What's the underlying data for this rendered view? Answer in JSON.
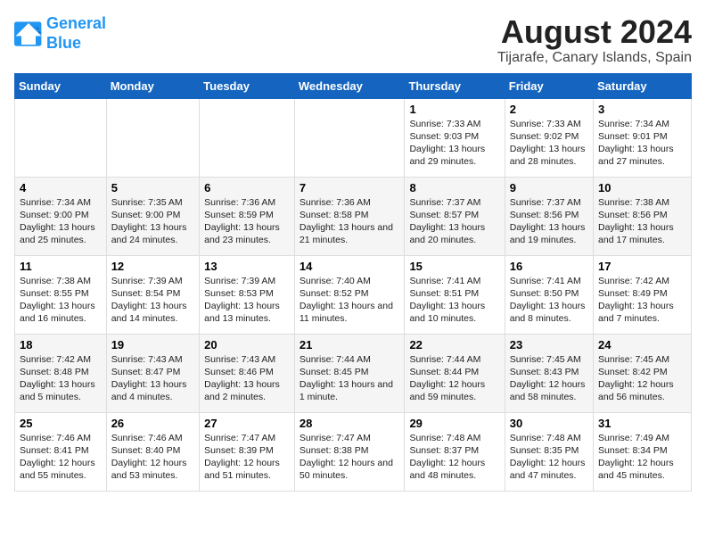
{
  "logo": {
    "line1": "General",
    "line2": "Blue"
  },
  "title": "August 2024",
  "subtitle": "Tijarafe, Canary Islands, Spain",
  "days_of_week": [
    "Sunday",
    "Monday",
    "Tuesday",
    "Wednesday",
    "Thursday",
    "Friday",
    "Saturday"
  ],
  "weeks": [
    [
      {
        "day": "",
        "content": ""
      },
      {
        "day": "",
        "content": ""
      },
      {
        "day": "",
        "content": ""
      },
      {
        "day": "",
        "content": ""
      },
      {
        "day": "1",
        "content": "Sunrise: 7:33 AM\nSunset: 9:03 PM\nDaylight: 13 hours\nand 29 minutes."
      },
      {
        "day": "2",
        "content": "Sunrise: 7:33 AM\nSunset: 9:02 PM\nDaylight: 13 hours\nand 28 minutes."
      },
      {
        "day": "3",
        "content": "Sunrise: 7:34 AM\nSunset: 9:01 PM\nDaylight: 13 hours\nand 27 minutes."
      }
    ],
    [
      {
        "day": "4",
        "content": "Sunrise: 7:34 AM\nSunset: 9:00 PM\nDaylight: 13 hours\nand 25 minutes."
      },
      {
        "day": "5",
        "content": "Sunrise: 7:35 AM\nSunset: 9:00 PM\nDaylight: 13 hours\nand 24 minutes."
      },
      {
        "day": "6",
        "content": "Sunrise: 7:36 AM\nSunset: 8:59 PM\nDaylight: 13 hours\nand 23 minutes."
      },
      {
        "day": "7",
        "content": "Sunrise: 7:36 AM\nSunset: 8:58 PM\nDaylight: 13 hours\nand 21 minutes."
      },
      {
        "day": "8",
        "content": "Sunrise: 7:37 AM\nSunset: 8:57 PM\nDaylight: 13 hours\nand 20 minutes."
      },
      {
        "day": "9",
        "content": "Sunrise: 7:37 AM\nSunset: 8:56 PM\nDaylight: 13 hours\nand 19 minutes."
      },
      {
        "day": "10",
        "content": "Sunrise: 7:38 AM\nSunset: 8:56 PM\nDaylight: 13 hours\nand 17 minutes."
      }
    ],
    [
      {
        "day": "11",
        "content": "Sunrise: 7:38 AM\nSunset: 8:55 PM\nDaylight: 13 hours\nand 16 minutes."
      },
      {
        "day": "12",
        "content": "Sunrise: 7:39 AM\nSunset: 8:54 PM\nDaylight: 13 hours\nand 14 minutes."
      },
      {
        "day": "13",
        "content": "Sunrise: 7:39 AM\nSunset: 8:53 PM\nDaylight: 13 hours\nand 13 minutes."
      },
      {
        "day": "14",
        "content": "Sunrise: 7:40 AM\nSunset: 8:52 PM\nDaylight: 13 hours\nand 11 minutes."
      },
      {
        "day": "15",
        "content": "Sunrise: 7:41 AM\nSunset: 8:51 PM\nDaylight: 13 hours\nand 10 minutes."
      },
      {
        "day": "16",
        "content": "Sunrise: 7:41 AM\nSunset: 8:50 PM\nDaylight: 13 hours\nand 8 minutes."
      },
      {
        "day": "17",
        "content": "Sunrise: 7:42 AM\nSunset: 8:49 PM\nDaylight: 13 hours\nand 7 minutes."
      }
    ],
    [
      {
        "day": "18",
        "content": "Sunrise: 7:42 AM\nSunset: 8:48 PM\nDaylight: 13 hours\nand 5 minutes."
      },
      {
        "day": "19",
        "content": "Sunrise: 7:43 AM\nSunset: 8:47 PM\nDaylight: 13 hours\nand 4 minutes."
      },
      {
        "day": "20",
        "content": "Sunrise: 7:43 AM\nSunset: 8:46 PM\nDaylight: 13 hours\nand 2 minutes."
      },
      {
        "day": "21",
        "content": "Sunrise: 7:44 AM\nSunset: 8:45 PM\nDaylight: 13 hours\nand 1 minute."
      },
      {
        "day": "22",
        "content": "Sunrise: 7:44 AM\nSunset: 8:44 PM\nDaylight: 12 hours\nand 59 minutes."
      },
      {
        "day": "23",
        "content": "Sunrise: 7:45 AM\nSunset: 8:43 PM\nDaylight: 12 hours\nand 58 minutes."
      },
      {
        "day": "24",
        "content": "Sunrise: 7:45 AM\nSunset: 8:42 PM\nDaylight: 12 hours\nand 56 minutes."
      }
    ],
    [
      {
        "day": "25",
        "content": "Sunrise: 7:46 AM\nSunset: 8:41 PM\nDaylight: 12 hours\nand 55 minutes."
      },
      {
        "day": "26",
        "content": "Sunrise: 7:46 AM\nSunset: 8:40 PM\nDaylight: 12 hours\nand 53 minutes."
      },
      {
        "day": "27",
        "content": "Sunrise: 7:47 AM\nSunset: 8:39 PM\nDaylight: 12 hours\nand 51 minutes."
      },
      {
        "day": "28",
        "content": "Sunrise: 7:47 AM\nSunset: 8:38 PM\nDaylight: 12 hours\nand 50 minutes."
      },
      {
        "day": "29",
        "content": "Sunrise: 7:48 AM\nSunset: 8:37 PM\nDaylight: 12 hours\nand 48 minutes."
      },
      {
        "day": "30",
        "content": "Sunrise: 7:48 AM\nSunset: 8:35 PM\nDaylight: 12 hours\nand 47 minutes."
      },
      {
        "day": "31",
        "content": "Sunrise: 7:49 AM\nSunset: 8:34 PM\nDaylight: 12 hours\nand 45 minutes."
      }
    ]
  ]
}
